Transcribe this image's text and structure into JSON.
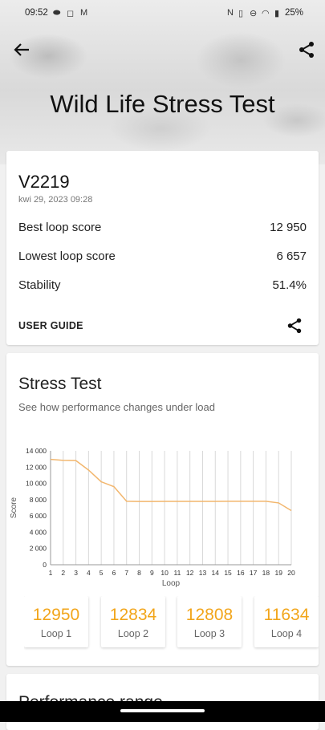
{
  "status_bar": {
    "time": "09:52",
    "battery": "25%",
    "icons": [
      "discord-icon",
      "instagram-icon",
      "gmail-icon",
      "nfc-icon",
      "vibrate-icon",
      "dnd-icon",
      "wifi-icon",
      "battery-icon"
    ]
  },
  "header": {
    "title": "Wild Life Stress Test"
  },
  "summary": {
    "device": "V2219",
    "date": "kwi 29, 2023 09:28",
    "rows": [
      {
        "label": "Best loop score",
        "value": "12 950"
      },
      {
        "label": "Lowest loop score",
        "value": "6 657"
      },
      {
        "label": "Stability",
        "value": "51.4%"
      }
    ],
    "user_guide": "USER GUIDE"
  },
  "stress_test": {
    "title": "Stress Test",
    "subtitle": "See how performance changes under load",
    "loops": [
      {
        "value": "12950",
        "label": "Loop 1"
      },
      {
        "value": "12834",
        "label": "Loop 2"
      },
      {
        "value": "12808",
        "label": "Loop 3"
      },
      {
        "value": "11634",
        "label": "Loop 4"
      }
    ]
  },
  "chart_data": {
    "type": "line",
    "xlabel": "Loop",
    "ylabel": "Score",
    "x": [
      1,
      2,
      3,
      4,
      5,
      6,
      7,
      8,
      9,
      10,
      11,
      12,
      13,
      14,
      15,
      16,
      17,
      18,
      19,
      20
    ],
    "x_tick_labels": [
      "1",
      "2",
      "3",
      "4",
      "5",
      "6",
      "7",
      "8",
      "9",
      "10",
      "11",
      "12",
      "13",
      "14",
      "15",
      "16",
      "17",
      "18",
      "19",
      "20"
    ],
    "y_ticks": [
      0,
      2000,
      4000,
      6000,
      8000,
      10000,
      12000,
      14000
    ],
    "y_tick_labels": [
      "0",
      "2 000",
      "4 000",
      "6 000",
      "8 000",
      "10 000",
      "12 000",
      "14 000"
    ],
    "ylim": [
      0,
      14000
    ],
    "grid": "vertical",
    "line_color": "#f2b66d",
    "series": [
      {
        "values": [
          12950,
          12834,
          12808,
          11634,
          10200,
          9600,
          7800,
          7780,
          7780,
          7785,
          7790,
          7790,
          7790,
          7790,
          7800,
          7800,
          7800,
          7800,
          7600,
          6657
        ]
      }
    ]
  },
  "performance": {
    "title": "Performance range"
  }
}
